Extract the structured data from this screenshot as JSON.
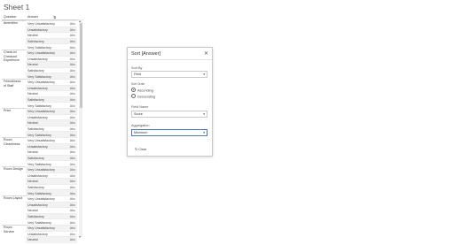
{
  "sheet_title": "Sheet 1",
  "table": {
    "col_question": "Question",
    "col_answer": "Answer",
    "cell_value": "Abc",
    "groups": [
      {
        "question": [
          "Amenities"
        ],
        "answers": [
          "Very Unsatisfactory",
          "Unsatisfactory",
          "Neutral",
          "Satisfactory",
          "Very Satisfactory"
        ]
      },
      {
        "question": [
          "Check-in/",
          "Checkout",
          "Experience"
        ],
        "answers": [
          "Very Unsatisfactory",
          "Unsatisfactory",
          "Neutral",
          "Satisfactory",
          "Very Satisfactory"
        ]
      },
      {
        "question": [
          "Friendliness",
          "of Staff"
        ],
        "answers": [
          "Very Unsatisfactory",
          "Unsatisfactory",
          "Neutral",
          "Satisfactory",
          "Very Satisfactory"
        ]
      },
      {
        "question": [
          "Price"
        ],
        "answers": [
          "Very Unsatisfactory",
          "Unsatisfactory",
          "Neutral",
          "Satisfactory",
          "Very Satisfactory"
        ]
      },
      {
        "question": [
          "Room",
          "Cleanliness"
        ],
        "answers": [
          "Very Unsatisfactory",
          "Unsatisfactory",
          "Neutral",
          "Satisfactory",
          "Very Satisfactory"
        ]
      },
      {
        "question": [
          "Room Design"
        ],
        "answers": [
          "Very Unsatisfactory",
          "Unsatisfactory",
          "Neutral",
          "Satisfactory",
          "Very Satisfactory"
        ]
      },
      {
        "question": [
          "Room Layout"
        ],
        "answers": [
          "Very Unsatisfactory",
          "Unsatisfactory",
          "Neutral",
          "Satisfactory",
          "Very Satisfactory"
        ]
      },
      {
        "question": [
          "Room",
          "Service"
        ],
        "answers": [
          "Very Unsatisfactory",
          "Unsatisfactory",
          "Neutral"
        ]
      }
    ]
  },
  "dialog": {
    "title": "Sort [Answer]",
    "close_glyph": "✕",
    "sort_by_label": "Sort By",
    "sort_by_value": "Field",
    "sort_order_label": "Sort Order",
    "ascending": "Ascending",
    "descending": "Descending",
    "field_name_label": "Field Name",
    "field_name_value": "Score",
    "aggregation_label": "Aggregation",
    "aggregation_value": "Minimum",
    "clear_label": "↻  Clear",
    "caret": "▾"
  }
}
